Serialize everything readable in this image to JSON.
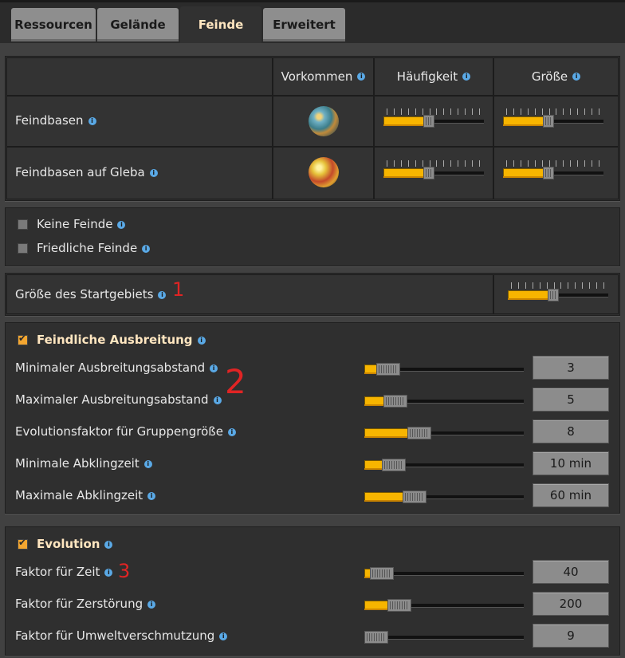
{
  "tabs": [
    {
      "label": "Ressourcen",
      "active": false
    },
    {
      "label": "Gelände",
      "active": false
    },
    {
      "label": "Feinde",
      "active": true
    },
    {
      "label": "Erweitert",
      "active": false
    }
  ],
  "table": {
    "columns": [
      "Vorkommen",
      "Häufigkeit",
      "Größe"
    ],
    "rows": [
      {
        "label": "Feindbasen",
        "planet": "nauvis-planet-icon",
        "frequency": 0.45,
        "size": 0.45
      },
      {
        "label": "Feindbasen auf Gleba",
        "planet": "gleba-planet-icon",
        "frequency": 0.45,
        "size": 0.45
      }
    ]
  },
  "toggles": [
    {
      "label": "Keine Feinde",
      "checked": false
    },
    {
      "label": "Friedliche Feinde",
      "checked": false
    }
  ],
  "starting_area": {
    "label": "Größe des Startgebiets",
    "value": 0.45
  },
  "expansion": {
    "title": "Feindliche Ausbreitung",
    "checked": true,
    "rows": [
      {
        "label": "Minimaler Ausbreitungsabstand",
        "value": "3",
        "fraction": 0.09
      },
      {
        "label": "Maximaler Ausbreitungsabstand",
        "value": "5",
        "fraction": 0.14
      },
      {
        "label": "Evolutionsfaktor für Gruppengröße",
        "value": "8",
        "fraction": 0.32
      },
      {
        "label": "Minimale Abklingzeit",
        "value": "10 min",
        "fraction": 0.13
      },
      {
        "label": "Maximale Abklingzeit",
        "value": "60 min",
        "fraction": 0.28
      }
    ]
  },
  "evolution": {
    "title": "Evolution",
    "checked": true,
    "rows": [
      {
        "label": "Faktor für Zeit",
        "value": "40",
        "fraction": 0.04
      },
      {
        "label": "Faktor für Zerstörung",
        "value": "200",
        "fraction": 0.17
      },
      {
        "label": "Faktor für Umweltverschmutzung",
        "value": "9",
        "fraction": 0.0
      }
    ]
  },
  "annotations": [
    "1",
    "2",
    "3"
  ],
  "colors": {
    "accent": "#f7b500",
    "info": "#5aa9e6",
    "annotation": "#e02424",
    "header_text": "#ffe6c0"
  }
}
